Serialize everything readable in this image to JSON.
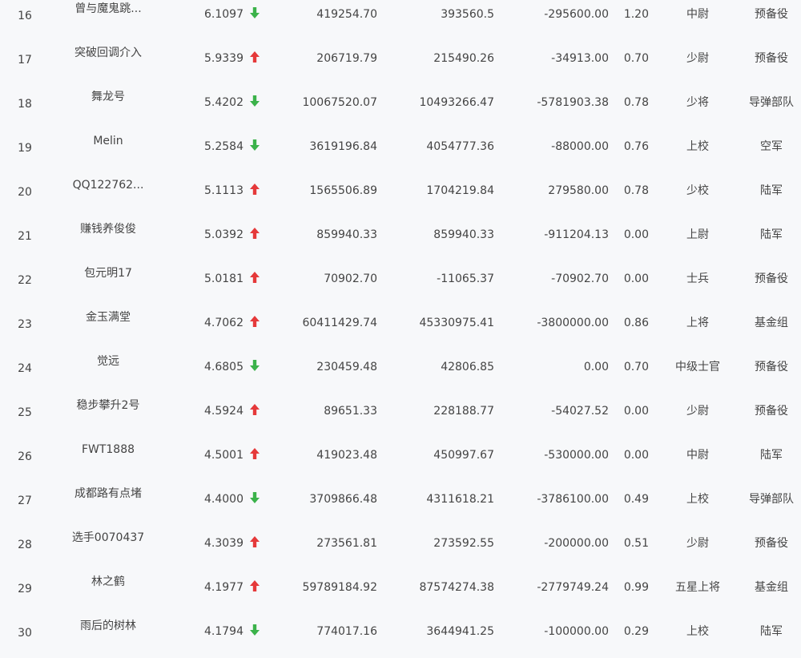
{
  "colors": {
    "up": "#e5393a",
    "down": "#3bb24a",
    "background": "#f7f8fa",
    "text": "#444444"
  },
  "rows": [
    {
      "rank": "16",
      "name": "曾与魔鬼跳...",
      "score": "6.1097",
      "trend": "down",
      "v1": "419254.70",
      "v2": "393560.5",
      "v3": "-295600.00",
      "v4": "1.20",
      "grade": "中尉",
      "branch": "预备役"
    },
    {
      "rank": "17",
      "name": "突破回调介入",
      "score": "5.9339",
      "trend": "up",
      "v1": "206719.79",
      "v2": "215490.26",
      "v3": "-34913.00",
      "v4": "0.70",
      "grade": "少尉",
      "branch": "预备役"
    },
    {
      "rank": "18",
      "name": "舞龙号",
      "score": "5.4202",
      "trend": "down",
      "v1": "10067520.07",
      "v2": "10493266.47",
      "v3": "-5781903.38",
      "v4": "0.78",
      "grade": "少将",
      "branch": "导弹部队"
    },
    {
      "rank": "19",
      "name": "Melin",
      "score": "5.2584",
      "trend": "down",
      "v1": "3619196.84",
      "v2": "4054777.36",
      "v3": "-88000.00",
      "v4": "0.76",
      "grade": "上校",
      "branch": "空军"
    },
    {
      "rank": "20",
      "name": "QQ122762...",
      "score": "5.1113",
      "trend": "up",
      "v1": "1565506.89",
      "v2": "1704219.84",
      "v3": "279580.00",
      "v4": "0.78",
      "grade": "少校",
      "branch": "陆军"
    },
    {
      "rank": "21",
      "name": "赚钱养俊俊",
      "score": "5.0392",
      "trend": "up",
      "v1": "859940.33",
      "v2": "859940.33",
      "v3": "-911204.13",
      "v4": "0.00",
      "grade": "上尉",
      "branch": "陆军"
    },
    {
      "rank": "22",
      "name": "包元明17",
      "score": "5.0181",
      "trend": "up",
      "v1": "70902.70",
      "v2": "-11065.37",
      "v3": "-70902.70",
      "v4": "0.00",
      "grade": "士兵",
      "branch": "预备役"
    },
    {
      "rank": "23",
      "name": "金玉满堂",
      "score": "4.7062",
      "trend": "up",
      "v1": "60411429.74",
      "v2": "45330975.41",
      "v3": "-3800000.00",
      "v4": "0.86",
      "grade": "上将",
      "branch": "基金组"
    },
    {
      "rank": "24",
      "name": "觉远",
      "score": "4.6805",
      "trend": "down",
      "v1": "230459.48",
      "v2": "42806.85",
      "v3": "0.00",
      "v4": "0.70",
      "grade": "中级士官",
      "branch": "预备役"
    },
    {
      "rank": "25",
      "name": "稳步攀升2号",
      "score": "4.5924",
      "trend": "up",
      "v1": "89651.33",
      "v2": "228188.77",
      "v3": "-54027.52",
      "v4": "0.00",
      "grade": "少尉",
      "branch": "预备役"
    },
    {
      "rank": "26",
      "name": "FWT1888",
      "score": "4.5001",
      "trend": "up",
      "v1": "419023.48",
      "v2": "450997.67",
      "v3": "-530000.00",
      "v4": "0.00",
      "grade": "中尉",
      "branch": "陆军"
    },
    {
      "rank": "27",
      "name": "成都路有点堵",
      "score": "4.4000",
      "trend": "down",
      "v1": "3709866.48",
      "v2": "4311618.21",
      "v3": "-3786100.00",
      "v4": "0.49",
      "grade": "上校",
      "branch": "导弹部队"
    },
    {
      "rank": "28",
      "name": "选手0070437",
      "score": "4.3039",
      "trend": "up",
      "v1": "273561.81",
      "v2": "273592.55",
      "v3": "-200000.00",
      "v4": "0.51",
      "grade": "少尉",
      "branch": "预备役"
    },
    {
      "rank": "29",
      "name": "林之鹤",
      "score": "4.1977",
      "trend": "up",
      "v1": "59789184.92",
      "v2": "87574274.38",
      "v3": "-2779749.24",
      "v4": "0.99",
      "grade": "五星上将",
      "branch": "基金组"
    },
    {
      "rank": "30",
      "name": "雨后的树林",
      "score": "4.1794",
      "trend": "down",
      "v1": "774017.16",
      "v2": "3644941.25",
      "v3": "-100000.00",
      "v4": "0.29",
      "grade": "上校",
      "branch": "陆军"
    }
  ]
}
